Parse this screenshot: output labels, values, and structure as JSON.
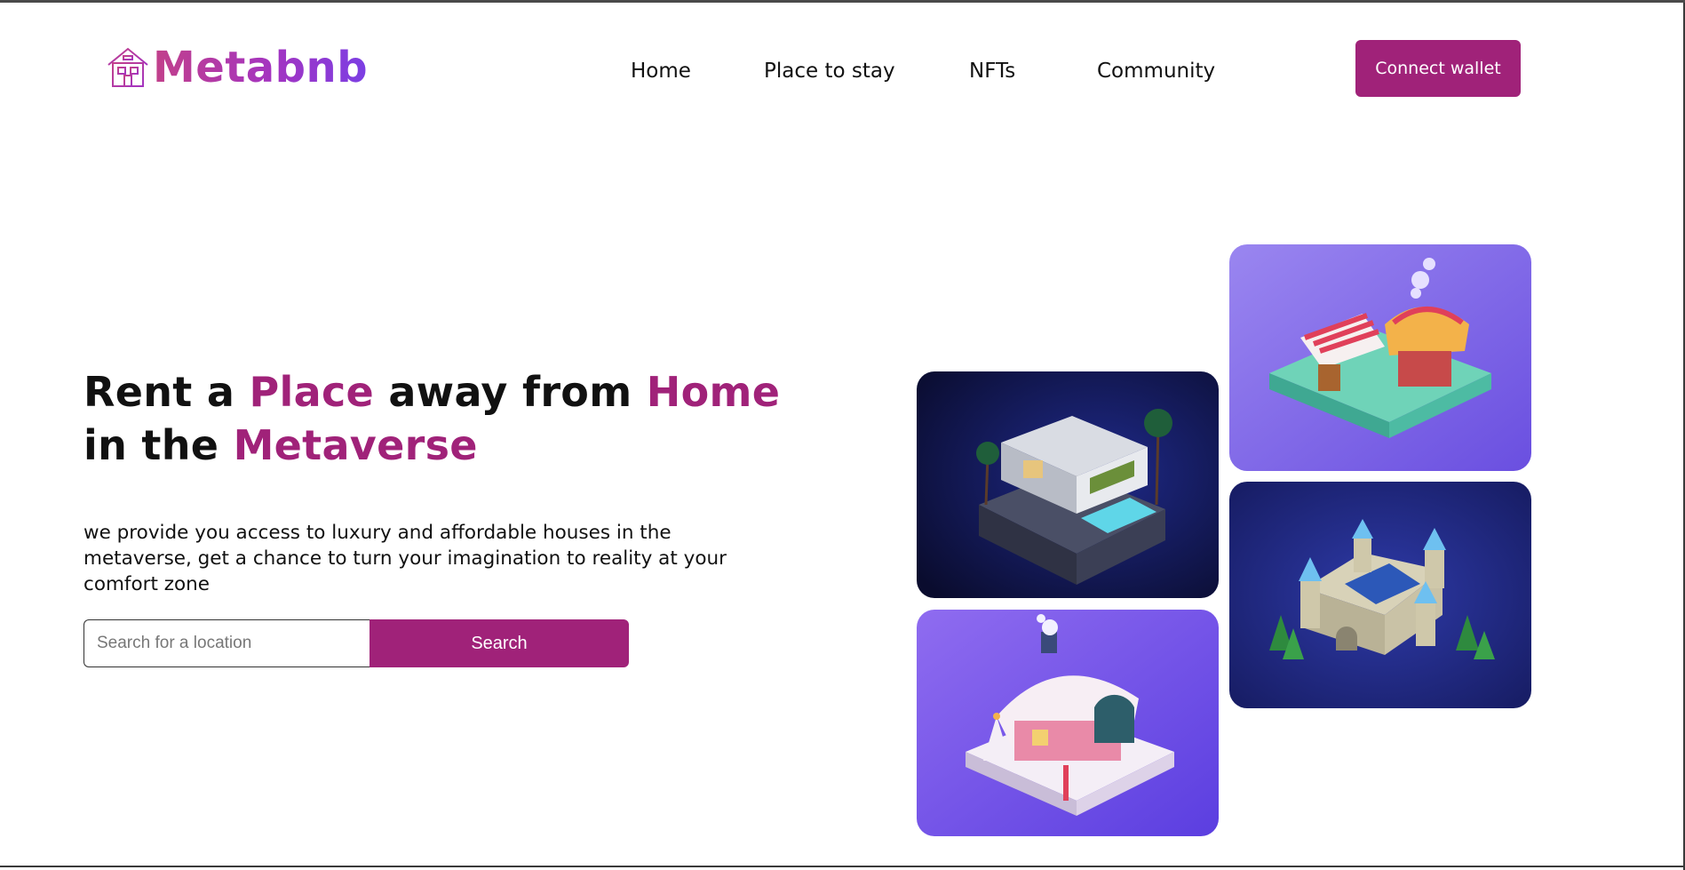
{
  "brand": {
    "name": "Metabnb",
    "icon": "house-logo-icon"
  },
  "nav": {
    "items": [
      {
        "label": "Home"
      },
      {
        "label": "Place to stay"
      },
      {
        "label": "NFTs"
      },
      {
        "label": "Community"
      }
    ],
    "connect_wallet_label": "Connect wallet"
  },
  "hero": {
    "title_parts": {
      "p1": "Rent a ",
      "p2": "Place",
      "p3": " away from ",
      "p4": "Home",
      "p5": " in the ",
      "p6": "Metaverse"
    },
    "description": "we provide you access to luxury and affordable houses in the metaverse, get a chance to turn your imagination to reality at your comfort zone",
    "search": {
      "placeholder": "Search for a location",
      "value": "",
      "button_label": "Search"
    }
  },
  "gallery": {
    "images": [
      {
        "subject": "modern-villa-image"
      },
      {
        "subject": "market-stall-image"
      },
      {
        "subject": "castle-image"
      },
      {
        "subject": "snow-cottage-image"
      }
    ]
  },
  "colors": {
    "accent": "#a02279",
    "logo_gradient_start": "#c2408a",
    "logo_gradient_end": "#7b3fe4",
    "text": "#111111"
  }
}
